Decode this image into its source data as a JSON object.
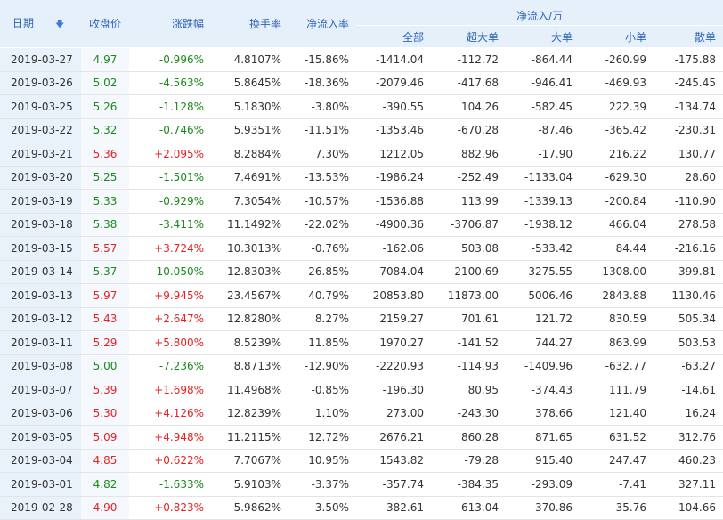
{
  "header": {
    "date": "日期",
    "close": "收盘价",
    "change": "涨跌幅",
    "turnover": "换手率",
    "net_ratio": "净流入率",
    "net_flow_group": "净流入/万",
    "all": "全部",
    "super_large": "超大单",
    "large": "大单",
    "small": "小单",
    "retail": "散单"
  },
  "colors": {
    "up": "#e62222",
    "down": "#1a8a1a",
    "header_text": "#2f64b9",
    "header_bg": "#e6f0fb"
  },
  "rows": [
    {
      "date": "2019-03-27",
      "close": "4.97",
      "change": "-0.996%",
      "turnover": "4.8107%",
      "ratio": "-15.86%",
      "all": "-1414.04",
      "super": "-112.72",
      "large": "-864.44",
      "small": "-260.99",
      "retail": "-175.88",
      "dir": "down"
    },
    {
      "date": "2019-03-26",
      "close": "5.02",
      "change": "-4.563%",
      "turnover": "5.8645%",
      "ratio": "-18.36%",
      "all": "-2079.46",
      "super": "-417.68",
      "large": "-946.41",
      "small": "-469.93",
      "retail": "-245.45",
      "dir": "down"
    },
    {
      "date": "2019-03-25",
      "close": "5.26",
      "change": "-1.128%",
      "turnover": "5.1830%",
      "ratio": "-3.80%",
      "all": "-390.55",
      "super": "104.26",
      "large": "-582.45",
      "small": "222.39",
      "retail": "-134.74",
      "dir": "down"
    },
    {
      "date": "2019-03-22",
      "close": "5.32",
      "change": "-0.746%",
      "turnover": "5.9351%",
      "ratio": "-11.51%",
      "all": "-1353.46",
      "super": "-670.28",
      "large": "-87.46",
      "small": "-365.42",
      "retail": "-230.31",
      "dir": "down"
    },
    {
      "date": "2019-03-21",
      "close": "5.36",
      "change": "+2.095%",
      "turnover": "8.2884%",
      "ratio": "7.30%",
      "all": "1212.05",
      "super": "882.96",
      "large": "-17.90",
      "small": "216.22",
      "retail": "130.77",
      "dir": "up"
    },
    {
      "date": "2019-03-20",
      "close": "5.25",
      "change": "-1.501%",
      "turnover": "7.4691%",
      "ratio": "-13.53%",
      "all": "-1986.24",
      "super": "-252.49",
      "large": "-1133.04",
      "small": "-629.30",
      "retail": "28.60",
      "dir": "down"
    },
    {
      "date": "2019-03-19",
      "close": "5.33",
      "change": "-0.929%",
      "turnover": "7.3054%",
      "ratio": "-10.57%",
      "all": "-1536.88",
      "super": "113.99",
      "large": "-1339.13",
      "small": "-200.84",
      "retail": "-110.90",
      "dir": "down"
    },
    {
      "date": "2019-03-18",
      "close": "5.38",
      "change": "-3.411%",
      "turnover": "11.1492%",
      "ratio": "-22.02%",
      "all": "-4900.36",
      "super": "-3706.87",
      "large": "-1938.12",
      "small": "466.04",
      "retail": "278.58",
      "dir": "down"
    },
    {
      "date": "2019-03-15",
      "close": "5.57",
      "change": "+3.724%",
      "turnover": "10.3013%",
      "ratio": "-0.76%",
      "all": "-162.06",
      "super": "503.08",
      "large": "-533.42",
      "small": "84.44",
      "retail": "-216.16",
      "dir": "up"
    },
    {
      "date": "2019-03-14",
      "close": "5.37",
      "change": "-10.050%",
      "turnover": "12.8303%",
      "ratio": "-26.85%",
      "all": "-7084.04",
      "super": "-2100.69",
      "large": "-3275.55",
      "small": "-1308.00",
      "retail": "-399.81",
      "dir": "down"
    },
    {
      "date": "2019-03-13",
      "close": "5.97",
      "change": "+9.945%",
      "turnover": "23.4567%",
      "ratio": "40.79%",
      "all": "20853.80",
      "super": "11873.00",
      "large": "5006.46",
      "small": "2843.88",
      "retail": "1130.46",
      "dir": "up"
    },
    {
      "date": "2019-03-12",
      "close": "5.43",
      "change": "+2.647%",
      "turnover": "12.8280%",
      "ratio": "8.27%",
      "all": "2159.27",
      "super": "701.61",
      "large": "121.72",
      "small": "830.59",
      "retail": "505.34",
      "dir": "up"
    },
    {
      "date": "2019-03-11",
      "close": "5.29",
      "change": "+5.800%",
      "turnover": "8.5239%",
      "ratio": "11.85%",
      "all": "1970.27",
      "super": "-141.52",
      "large": "744.27",
      "small": "863.99",
      "retail": "503.53",
      "dir": "up"
    },
    {
      "date": "2019-03-08",
      "close": "5.00",
      "change": "-7.236%",
      "turnover": "8.8713%",
      "ratio": "-12.90%",
      "all": "-2220.93",
      "super": "-114.93",
      "large": "-1409.96",
      "small": "-632.77",
      "retail": "-63.27",
      "dir": "down"
    },
    {
      "date": "2019-03-07",
      "close": "5.39",
      "change": "+1.698%",
      "turnover": "11.4968%",
      "ratio": "-0.85%",
      "all": "-196.30",
      "super": "80.95",
      "large": "-374.43",
      "small": "111.79",
      "retail": "-14.61",
      "dir": "up"
    },
    {
      "date": "2019-03-06",
      "close": "5.30",
      "change": "+4.126%",
      "turnover": "12.8239%",
      "ratio": "1.10%",
      "all": "273.00",
      "super": "-243.30",
      "large": "378.66",
      "small": "121.40",
      "retail": "16.24",
      "dir": "up"
    },
    {
      "date": "2019-03-05",
      "close": "5.09",
      "change": "+4.948%",
      "turnover": "11.2115%",
      "ratio": "12.72%",
      "all": "2676.21",
      "super": "860.28",
      "large": "871.65",
      "small": "631.52",
      "retail": "312.76",
      "dir": "up"
    },
    {
      "date": "2019-03-04",
      "close": "4.85",
      "change": "+0.622%",
      "turnover": "7.7067%",
      "ratio": "10.95%",
      "all": "1543.82",
      "super": "-79.28",
      "large": "915.40",
      "small": "247.47",
      "retail": "460.23",
      "dir": "up"
    },
    {
      "date": "2019-03-01",
      "close": "4.82",
      "change": "-1.633%",
      "turnover": "5.9103%",
      "ratio": "-3.37%",
      "all": "-357.74",
      "super": "-384.35",
      "large": "-293.09",
      "small": "-7.41",
      "retail": "327.11",
      "dir": "down"
    },
    {
      "date": "2019-02-28",
      "close": "4.90",
      "change": "+0.823%",
      "turnover": "5.9862%",
      "ratio": "-3.50%",
      "all": "-382.61",
      "super": "-613.04",
      "large": "370.86",
      "small": "-35.76",
      "retail": "-104.66",
      "dir": "up"
    }
  ]
}
